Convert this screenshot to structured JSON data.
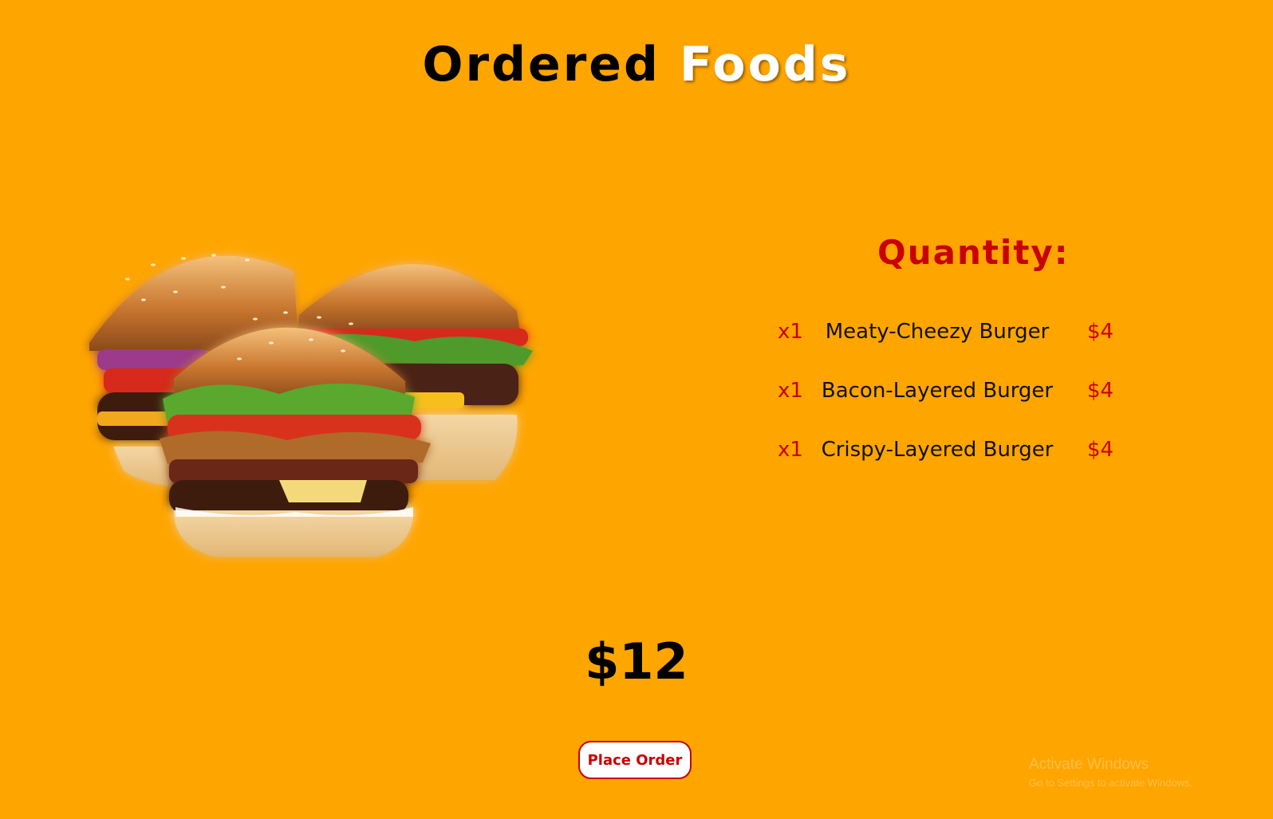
{
  "page": {
    "title_part1": "Ordered",
    "title_part2": "Foods"
  },
  "image": {
    "description": "burgers-photo"
  },
  "quantity": {
    "heading": "Quantity:",
    "items": [
      {
        "qty": "x1",
        "name": "Meaty-Cheezy Burger",
        "price": "$4"
      },
      {
        "qty": "x1",
        "name": "Bacon-Layered Burger",
        "price": "$4"
      },
      {
        "qty": "x1",
        "name": "Crispy-Layered Burger",
        "price": "$4"
      }
    ]
  },
  "total": "$12",
  "actions": {
    "place_order_label": "Place Order"
  },
  "watermark": {
    "line1": "Activate Windows",
    "line2": "Go to Settings to activate Windows."
  },
  "colors": {
    "background": "#ffa500",
    "accent_red": "#c80000",
    "title_highlight": "#ffffff"
  }
}
